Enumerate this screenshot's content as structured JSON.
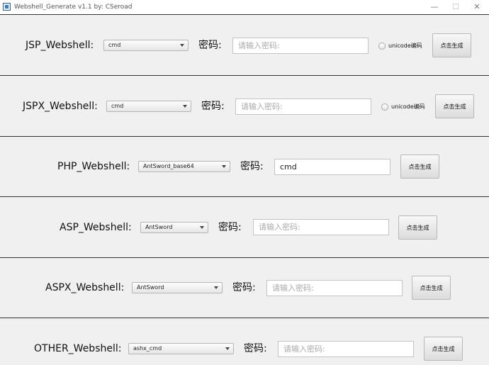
{
  "window": {
    "title": "Webshell_Generate v1.1   by: CSeroad",
    "minimize_glyph": "—",
    "maximize_glyph": "☐",
    "close_glyph": "✕",
    "app_icon": "app-icon"
  },
  "panels": [
    {
      "shell_label": "JSP_Webshell:",
      "type_selected": "cmd",
      "password_label": "密码:",
      "password_value": "",
      "password_placeholder": "请输入密码:",
      "unicode_label": "unicode编码",
      "generate_label": "点击生成"
    },
    {
      "shell_label": "JSPX_Webshell:",
      "type_selected": "cmd",
      "password_label": "密码:",
      "password_value": "",
      "password_placeholder": "请输入密码:",
      "unicode_label": "unicode编码",
      "generate_label": "点击生成"
    },
    {
      "shell_label": "PHP_Webshell:",
      "type_selected": "AntSword_base64",
      "password_label": "密码:",
      "password_value": "cmd",
      "password_placeholder": "",
      "generate_label": "点击生成"
    },
    {
      "shell_label": "ASP_Webshell:",
      "type_selected": "AntSword",
      "password_label": "密码:",
      "password_value": "",
      "password_placeholder": "请输入密码:",
      "generate_label": "点击生成"
    },
    {
      "shell_label": "ASPX_Webshell:",
      "type_selected": "AntSword",
      "password_label": "密码:",
      "password_value": "",
      "password_placeholder": "请输入密码:",
      "generate_label": "点击生成"
    },
    {
      "shell_label": "OTHER_Webshell:",
      "type_selected": "ashx_cmd",
      "password_label": "密码:",
      "password_value": "",
      "password_placeholder": "请输入密码:",
      "generate_label": "点击生成"
    }
  ]
}
